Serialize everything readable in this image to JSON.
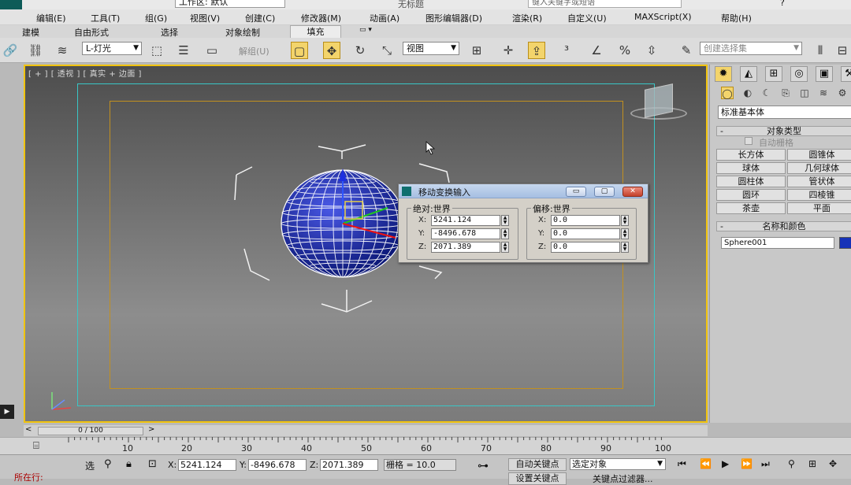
{
  "titlebar": {
    "workspace": "工作区: 默认",
    "doc_title": "无标题",
    "search_placeholder": "键入关键字或短语"
  },
  "menu": [
    "编辑(E)",
    "工具(T)",
    "组(G)",
    "视图(V)",
    "创建(C)",
    "修改器(M)",
    "动画(A)",
    "图形编辑器(D)",
    "渲染(R)",
    "自定义(U)",
    "MAXScript(X)",
    "帮助(H)"
  ],
  "ribbon_tabs": [
    "建模",
    "自由形式",
    "选择",
    "对象绘制",
    "填充"
  ],
  "toolbar": {
    "layer_combo": "L-灯光",
    "unlink_label": "解组(U)",
    "refcoord_combo": "视图",
    "selset_placeholder": "创建选择集",
    "icons": [
      "link-icon",
      "unlink-icon",
      "bind-spacewarp-icon",
      "select-object-icon",
      "select-by-name-icon",
      "region-select-icon",
      "move-icon",
      "rotate-icon",
      "scale-icon",
      "mirror-icon",
      "align-icon",
      "snap-icon",
      "angle-snap-icon",
      "percent-snap-icon"
    ]
  },
  "viewport": {
    "label": "[ + ] [ 透视 ] [ 真实 + 边面 ]",
    "highlight_color": "#f1c40f"
  },
  "dialog": {
    "title": "移动变换输入",
    "absolute_group": "绝对:世界",
    "offset_group": "偏移:世界",
    "absolute": {
      "x": "5241.124",
      "y": "-8496.678",
      "z": "2071.389"
    },
    "offset": {
      "x": "0.0",
      "y": "0.0",
      "z": "0.0"
    },
    "axis_labels": {
      "x": "X:",
      "y": "Y:",
      "z": "Z:"
    }
  },
  "command_panel": {
    "category": "标准基本体",
    "object_type_header": "对象类型",
    "autogrid_label": "自动栅格",
    "object_buttons": [
      "长方体",
      "圆锥体",
      "球体",
      "几何球体",
      "圆柱体",
      "管状体",
      "圆环",
      "四棱锥",
      "茶壶",
      "平面"
    ],
    "name_color_header": "名称和颜色",
    "object_name": "Sphere001",
    "object_color": "#1632b8"
  },
  "timeslider": {
    "position": "0 / 100",
    "left": "<",
    "right": ">"
  },
  "trackbar_ticks": [
    "10",
    "15",
    "20",
    "25",
    "30",
    "35",
    "40",
    "45",
    "50",
    "55",
    "60",
    "65",
    "70",
    "75",
    "80",
    "85",
    "90",
    "95",
    "100"
  ],
  "trackbar_major": [
    "10",
    "20",
    "30",
    "40",
    "50",
    "60",
    "70",
    "80",
    "90",
    "100"
  ],
  "status": {
    "selected_label": "所在行:",
    "coord_x": "5241.124",
    "coord_y": "-8496.678",
    "coord_z": "2071.389",
    "x_label": "X:",
    "y_label": "Y:",
    "z_label": "Z:",
    "grid": "栅格 = 10.0",
    "autokey": "自动关键点",
    "setkey": "设置关键点",
    "key_filter_combo": "选定对象",
    "key_filters": "关键点过滤器..."
  }
}
